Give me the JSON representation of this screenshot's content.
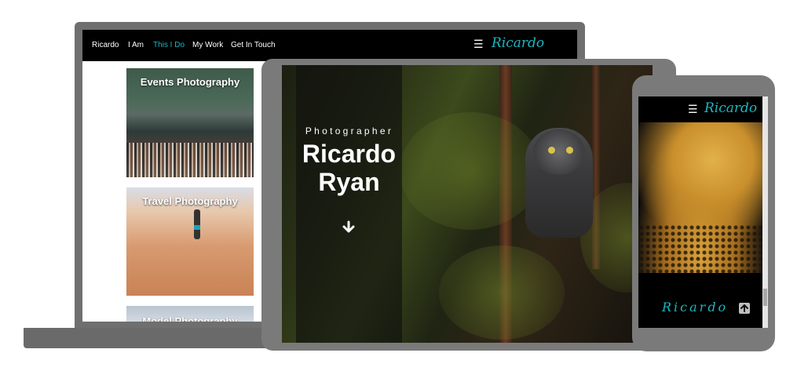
{
  "laptop": {
    "nav": {
      "items": [
        {
          "label": "Ricardo",
          "active": false
        },
        {
          "label": "I Am",
          "active": false
        },
        {
          "label": "This I Do",
          "active": true
        },
        {
          "label": "My Work",
          "active": false
        },
        {
          "label": "Get In Touch",
          "active": false
        }
      ],
      "menu_icon": "hamburger-icon",
      "brand": "Ricardo"
    },
    "cards": [
      {
        "title": "Events Photography"
      },
      {
        "title": "Travel Photography"
      },
      {
        "title": "Model Photography"
      }
    ]
  },
  "tablet": {
    "kicker": "Photographer",
    "name_line1": "Ricardo",
    "name_line2": "Ryan",
    "scroll_icon": "arrow-down-icon"
  },
  "phone": {
    "menu_icon": "hamburger-icon",
    "brand": "Ricardo",
    "footer_brand": "Ricardo",
    "top_icon": "arrow-up-icon"
  },
  "colors": {
    "accent": "#1bb7bf",
    "nav_bg": "#000000",
    "device_frame": "#6f6f6f"
  }
}
